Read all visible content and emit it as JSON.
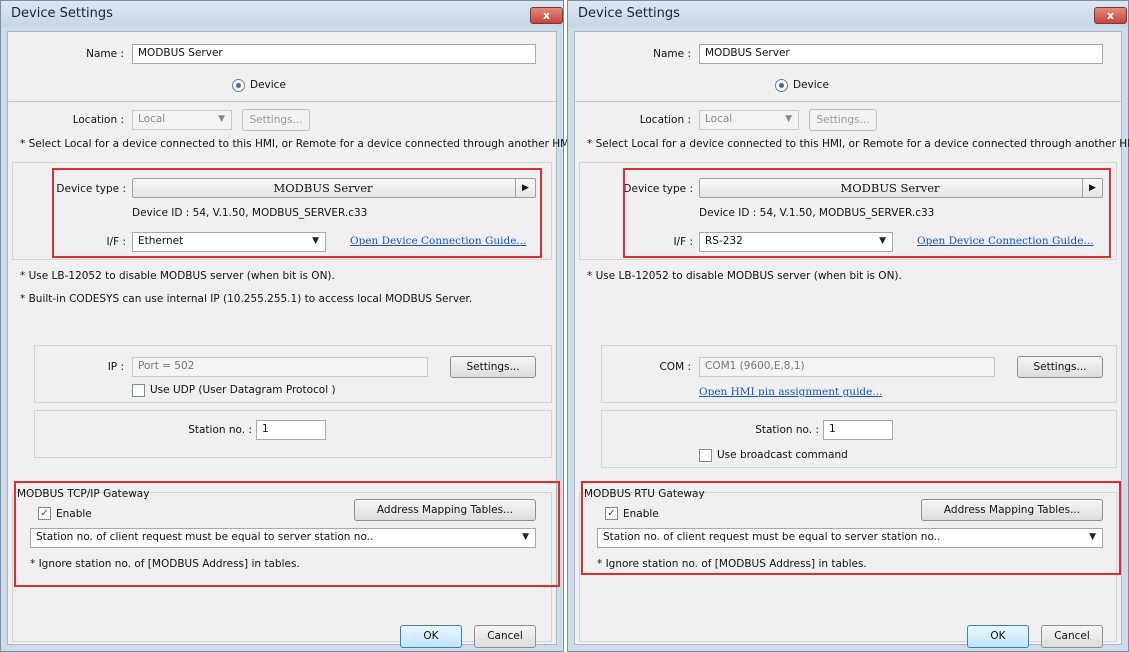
{
  "colors": {
    "highlight": "#dc3030",
    "link": "#1a4fd6",
    "title_bar": "#cfdbe8"
  },
  "left": {
    "title": "Device Settings",
    "close": "x",
    "name_label": "Name :",
    "name_value": "MODBUS Server",
    "device_radio": "Device",
    "location_label": "Location :",
    "location_value": "Local",
    "location_settings": "Settings...",
    "location_note": "* Select Local for a device connected to this HMI, or Remote for a device connected through another HMI.",
    "device_type_label": "Device type :",
    "device_type_value": "MODBUS Server",
    "device_id": "Device ID : 54, V.1.50, MODBUS_SERVER.c33",
    "if_label": "I/F :",
    "if_value": "Ethernet",
    "guide_link": "Open Device Connection Guide...",
    "note1": "* Use LB-12052 to disable MODBUS server (when bit is ON).",
    "note2": "* Built-in CODESYS can use internal IP (10.255.255.1) to access local MODBUS Server.",
    "ip_label": "IP :",
    "ip_value": "Port = 502",
    "ip_settings": "Settings...",
    "udp_label": "Use UDP (User Datagram Protocol )",
    "udp_checked": false,
    "station_label": "Station no. :",
    "station_value": "1",
    "gateway_title": "MODBUS TCP/IP Gateway",
    "enable_label": "Enable",
    "enable_checked": true,
    "mapping_button": "Address Mapping Tables...",
    "station_mode": "Station no. of client request must be equal to server station no..",
    "ignore_note": "* Ignore station no. of [MODBUS Address] in tables.",
    "ok": "OK",
    "cancel": "Cancel"
  },
  "right": {
    "title": "Device Settings",
    "close": "x",
    "name_label": "Name :",
    "name_value": "MODBUS Server",
    "device_radio": "Device",
    "location_label": "Location :",
    "location_value": "Local",
    "location_settings": "Settings...",
    "location_note": "* Select Local for a device connected to this HMI, or Remote for a device connected through another HMI.",
    "device_type_label": "Device type :",
    "device_type_value": "MODBUS Server",
    "device_id": "Device ID : 54, V.1.50, MODBUS_SERVER.c33",
    "if_label": "I/F :",
    "if_value": "RS-232",
    "guide_link": "Open Device Connection Guide...",
    "note1": "* Use LB-12052 to disable MODBUS server (when bit is ON).",
    "com_label": "COM :",
    "com_value": "COM1 (9600,E,8,1)",
    "com_settings": "Settings...",
    "pin_link": "Open HMI pin assignment guide...",
    "station_label": "Station no. :",
    "station_value": "1",
    "broadcast_label": "Use broadcast command",
    "broadcast_checked": false,
    "gateway_title": "MODBUS RTU Gateway",
    "enable_label": "Enable",
    "enable_checked": true,
    "mapping_button": "Address Mapping Tables...",
    "station_mode": "Station no. of client request must be equal to server station no..",
    "ignore_note": "* Ignore station no. of [MODBUS Address] in tables.",
    "ok": "OK",
    "cancel": "Cancel"
  }
}
